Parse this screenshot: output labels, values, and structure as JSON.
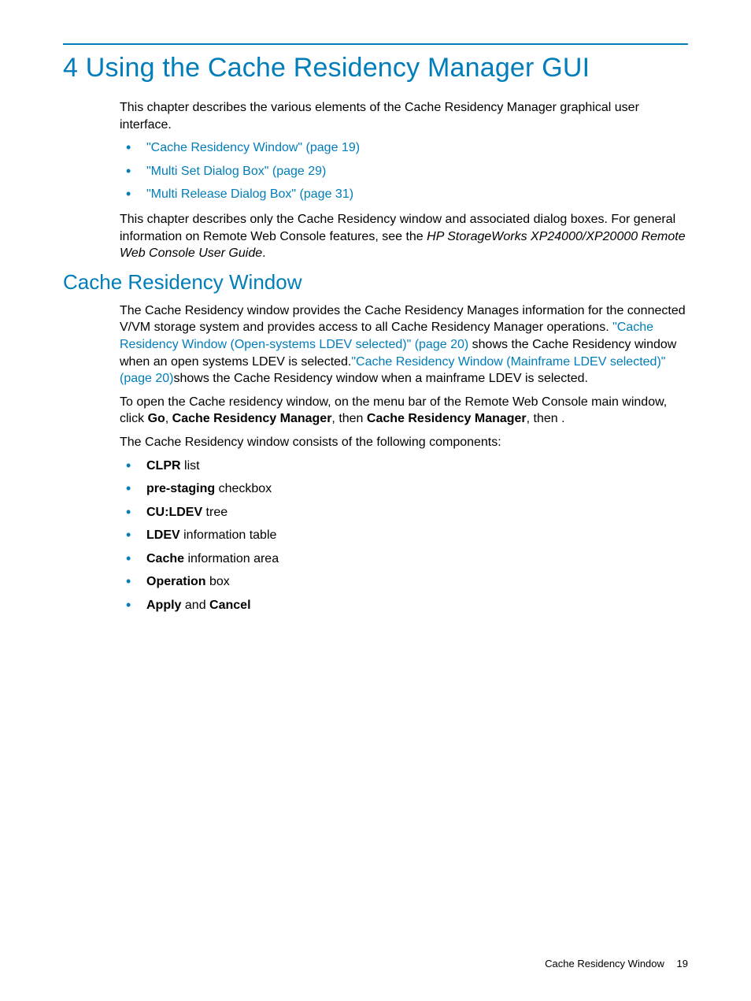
{
  "chapter": {
    "number": "4",
    "title": "Using the Cache Residency Manager GUI"
  },
  "intro": "This chapter describes the various elements of the Cache Residency Manager graphical user interface.",
  "toc_links": [
    {
      "text": "\"Cache Residency Window\" (page 19)"
    },
    {
      "text": "\"Multi Set Dialog Box\" (page 29)"
    },
    {
      "text": "\"Multi Release Dialog Box\" (page 31)"
    }
  ],
  "note_pre": "This chapter describes only the Cache Residency window and associated dialog boxes. For general information on Remote Web Console features, see the ",
  "note_italic": "HP StorageWorks XP24000/XP20000 Remote Web Console User Guide",
  "note_post": ".",
  "section": {
    "title": "Cache Residency Window",
    "p1_pre": "The Cache Residency window provides the Cache Residency Manages information for the connected V/VM storage system and provides access to all Cache Residency Manager operations. ",
    "p1_link1": "\"Cache Residency Window (Open-systems LDEV selected)\" (page 20)",
    "p1_mid": " shows the Cache Residency window when an open systems LDEV is selected.",
    "p1_link2": "\"Cache Residency Window (Mainframe LDEV selected)\" (page 20)",
    "p1_post": "shows the Cache Residency window when a mainframe LDEV is selected.",
    "p2_pre": "To open the Cache residency window, on the menu bar of the Remote Web Console main window, click ",
    "p2_b1": "Go",
    "p2_sep1": ", ",
    "p2_b2": "Cache Residency Manager",
    "p2_sep2": ", then ",
    "p2_b3": "Cache Residency Manager",
    "p2_post": ", then .",
    "p3": "The Cache Residency window consists of the following components:",
    "components": [
      {
        "bold": "CLPR",
        "rest": " list"
      },
      {
        "bold": "pre-staging",
        "rest": " checkbox"
      },
      {
        "bold": "CU:LDEV",
        "rest": " tree"
      },
      {
        "bold": "LDEV",
        "rest": " information table"
      },
      {
        "bold": "Cache",
        "rest": " information area"
      },
      {
        "bold": "Operation",
        "rest": " box"
      },
      {
        "bold": "Apply",
        "rest": " and ",
        "bold2": "Cancel"
      }
    ]
  },
  "footer": {
    "title": "Cache Residency Window",
    "page": "19"
  }
}
